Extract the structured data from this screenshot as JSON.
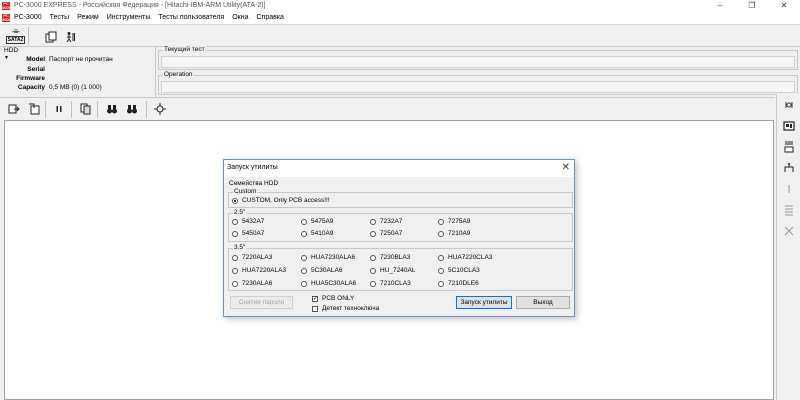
{
  "window": {
    "title": "PC-3000 EXPRESS - Российская Федерация - [Hitachi-IBM-ARM Utility(ATA-2)]",
    "logo": "PC 3000",
    "controls": [
      "‒",
      "❐",
      "✕"
    ]
  },
  "menu": {
    "items": [
      "PC-3000",
      "Тесты",
      "Режим",
      "Инструменты",
      "Тесты пользователя",
      "Окна",
      "Справка"
    ]
  },
  "toolbar": {
    "sata_label": "SATA2",
    "sata_glyph": "-≡-"
  },
  "hdd": {
    "title": "HDD",
    "rows": [
      {
        "label": "Model",
        "value": "Паспорт не прочитан"
      },
      {
        "label": "Serial",
        "value": ""
      },
      {
        "label": "Firmware",
        "value": ""
      },
      {
        "label": "Capacity",
        "value": "0,5 MB (0) (1 000)"
      }
    ]
  },
  "status": {
    "current_test_label": "Текущий тест",
    "operation_label": "Operation"
  },
  "dialog": {
    "title": "Запуск утилиты",
    "family_label": "Семейства HDD",
    "custom_group": "Custom",
    "custom_option": "CUSTOM, Only PCB access!!!",
    "group_25": "2.5\"",
    "options_25": [
      "5432A7",
      "5475A9",
      "7232A7",
      "7275A9",
      "5450A7",
      "5410A9",
      "7250A7",
      "7210A9"
    ],
    "group_35": "3.5\"",
    "options_35": [
      "7220ALA3",
      "HUA7230ALA6",
      "7230BLA3",
      "HUA7220CLA3",
      "HUA7220ALA3",
      "5C30ALA6",
      "HU_7240AL",
      "5C10CLA3",
      "7230ALA6",
      "HUA5C30ALA6",
      "7210CLA3",
      "7210DLE6"
    ],
    "remove_password_button": "Снятие пароля",
    "pcb_only_label": "PCB ONLY",
    "pcb_only_checked": true,
    "techno_key_label": "Детект техноключа",
    "techno_key_checked": false,
    "start_button": "Запуск утилиты",
    "exit_button": "Выход"
  }
}
